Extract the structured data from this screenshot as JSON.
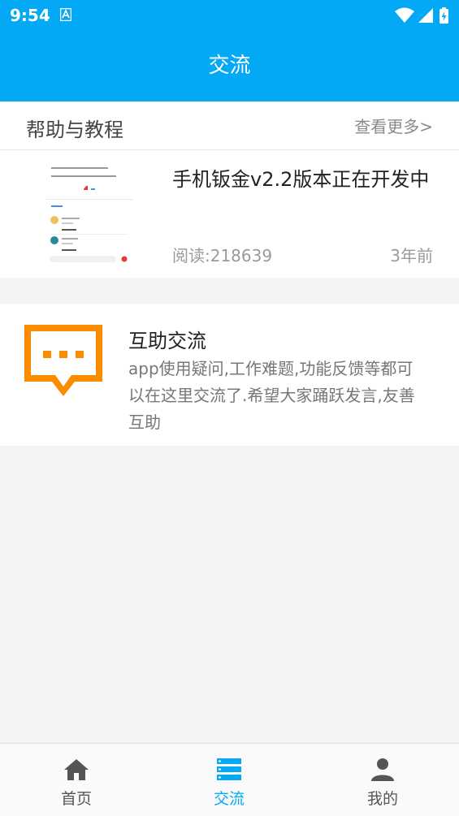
{
  "status_bar": {
    "time": "9:54"
  },
  "app_bar": {
    "title": "交流"
  },
  "help_section": {
    "label": "帮助与教程",
    "more_link": "查看更多>"
  },
  "article": {
    "title": "手机钣金v2.2版本正在开发中",
    "reads": "阅读:218639",
    "time_ago": "3年前"
  },
  "forum": {
    "title": "互助交流",
    "description": "app使用疑问,工作难题,功能反馈等都可以在这里交流了.希望大家踊跃发言,友善互助"
  },
  "bottom_nav": {
    "items": [
      {
        "label": "首页",
        "icon": "home-icon"
      },
      {
        "label": "交流",
        "icon": "list-icon"
      },
      {
        "label": "我的",
        "icon": "person-icon"
      }
    ]
  },
  "colors": {
    "primary": "#03a9f4",
    "orange": "#fb8c00",
    "nav_inactive": "#555555"
  }
}
